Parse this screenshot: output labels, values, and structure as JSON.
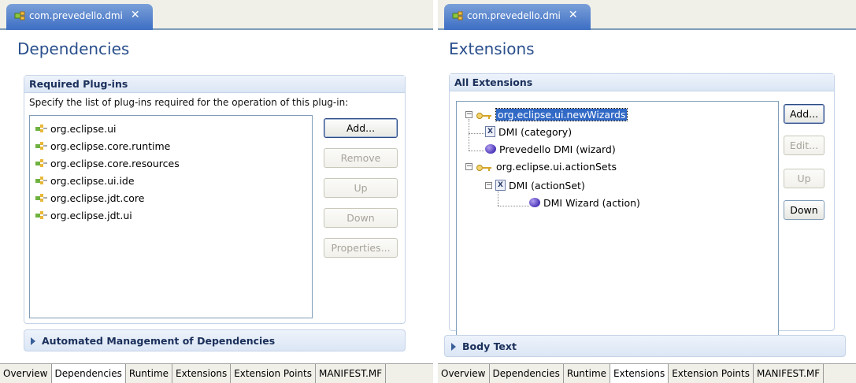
{
  "left": {
    "tab_title": "com.prevedello.dmi",
    "page_title": "Dependencies",
    "required_section": {
      "title": "Required Plug-ins",
      "description": "Specify the list of plug-ins required for the operation of this plug-in:",
      "plugins": [
        "org.eclipse.ui",
        "org.eclipse.core.runtime",
        "org.eclipse.core.resources",
        "org.eclipse.ui.ide",
        "org.eclipse.jdt.core",
        "org.eclipse.jdt.ui"
      ],
      "buttons": {
        "add": "Add...",
        "remove": "Remove",
        "up": "Up",
        "down": "Down",
        "properties": "Properties..."
      }
    },
    "automated_section": {
      "title": "Automated Management of Dependencies"
    },
    "bottom_tabs": [
      "Overview",
      "Dependencies",
      "Runtime",
      "Extensions",
      "Extension Points",
      "MANIFEST.MF"
    ],
    "active_bottom_tab": "Dependencies"
  },
  "right": {
    "tab_title": "com.prevedello.dmi",
    "page_title": "Extensions",
    "all_section": {
      "title": "All Extensions",
      "tree": {
        "ext1": "org.eclipse.ui.newWizards",
        "ext1_child1": "DMI (category)",
        "ext1_child2": "Prevedello DMI (wizard)",
        "ext2": "org.eclipse.ui.actionSets",
        "ext2_child1": "DMI (actionSet)",
        "ext2_grandchild1": "DMI Wizard (action)"
      },
      "buttons": {
        "add": "Add...",
        "edit": "Edit...",
        "up": "Up",
        "down": "Down"
      }
    },
    "body_section": {
      "title": "Body Text"
    },
    "bottom_tabs": [
      "Overview",
      "Dependencies",
      "Runtime",
      "Extensions",
      "Extension Points",
      "MANIFEST.MF"
    ],
    "active_bottom_tab": "Extensions"
  },
  "colors": {
    "accent": "#3d6ec4",
    "title": "#2a4f8c",
    "selection": "#3169c6"
  },
  "icons": {
    "tab": "plugin-icon",
    "close": "close-icon",
    "plugin": "plugin-icon",
    "extension": "extension-key-icon",
    "element": "x-element-icon",
    "action": "ball-icon"
  }
}
